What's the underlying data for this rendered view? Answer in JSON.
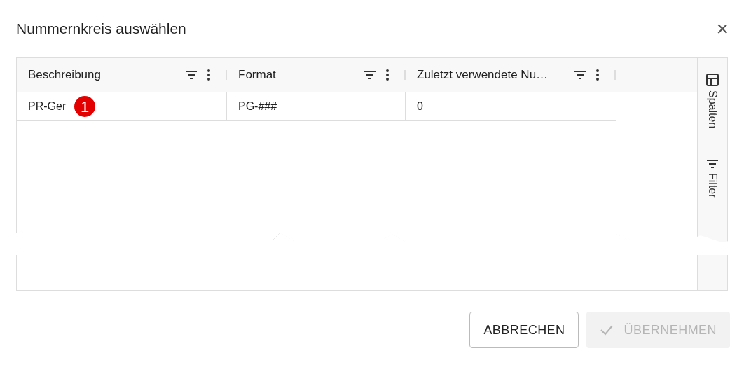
{
  "dialog": {
    "title": "Nummernkreis auswählen",
    "close": "×"
  },
  "table": {
    "columns": [
      {
        "label": "Beschreibung"
      },
      {
        "label": "Format"
      },
      {
        "label": "Zuletzt verwendete Nu…"
      }
    ],
    "rows": [
      {
        "cells": [
          "PR-Ger",
          "PG-###",
          "0"
        ],
        "badge": "1"
      }
    ]
  },
  "side_panel": {
    "items": [
      {
        "kind": "columns",
        "label": "Spalten"
      },
      {
        "kind": "filter",
        "label": "Filter"
      }
    ]
  },
  "buttons": [
    {
      "label": "ABBRECHEN",
      "disabled": false,
      "kind": "cancel"
    },
    {
      "label": "ÜBERNEHMEN",
      "disabled": true,
      "kind": "apply"
    }
  ]
}
